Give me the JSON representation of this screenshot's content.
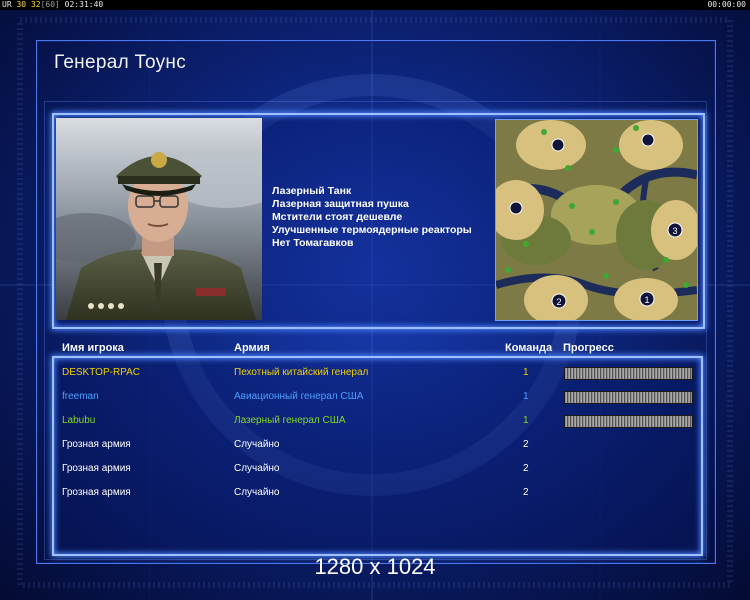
{
  "hud": {
    "left_fps_label": "UR",
    "left_fps_value": "30",
    "left_bits": "32",
    "left_bracket": "[60]",
    "left_clock": "02:31:40",
    "right_clock": "00:00:00"
  },
  "title": "Генерал Тоунс",
  "features": [
    "Лазерный Танк",
    "Лазерная защитная пушка",
    "Мстители стоят дешевле",
    "Улучшенные термоядерные реакторы",
    "Нет Томагавков"
  ],
  "map": {
    "start_positions": [
      "1",
      "2",
      "3"
    ]
  },
  "table": {
    "headers": {
      "player": "Имя игрока",
      "army": "Армия",
      "team": "Команда",
      "progress": "Прогресс"
    },
    "rows": [
      {
        "player": "DESKTOP-RPAC",
        "army": "Пехотный китайский генерал",
        "team": "1",
        "progress": 1.0,
        "color": "#f0d000"
      },
      {
        "player": "freeman",
        "army": "Авиационный генерал США",
        "team": "1",
        "progress": 1.0,
        "color": "#4aa0ff"
      },
      {
        "player": "Labubu",
        "army": "Лазерный генерал США",
        "team": "1",
        "progress": 1.0,
        "color": "#7ddc1f"
      },
      {
        "player": "Грозная армия",
        "army": "Случайно",
        "team": "2",
        "color": "#ffffff"
      },
      {
        "player": "Грозная армия",
        "army": "Случайно",
        "team": "2",
        "color": "#ffffff"
      },
      {
        "player": "Грозная армия",
        "army": "Случайно",
        "team": "2",
        "color": "#ffffff"
      }
    ]
  },
  "resolution": "1280 x 1024"
}
